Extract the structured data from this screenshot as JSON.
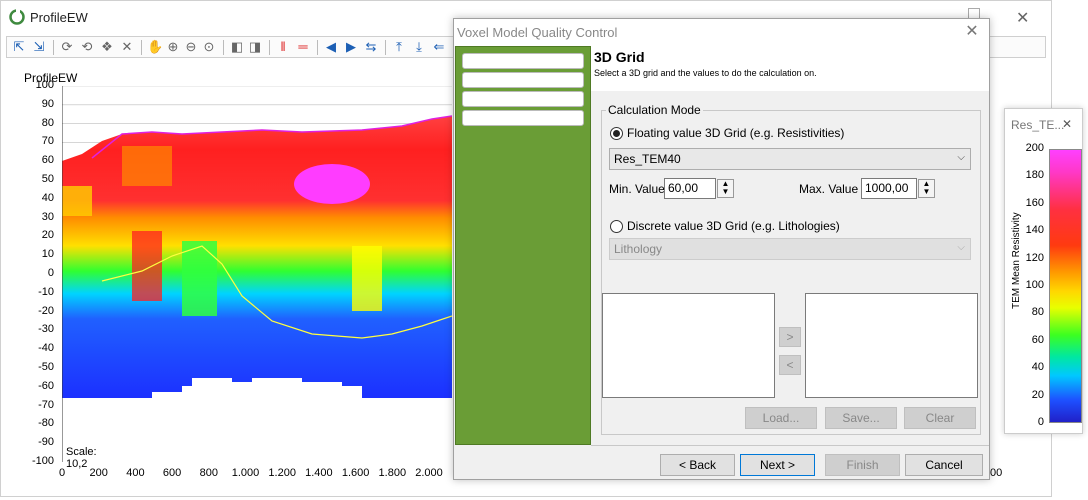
{
  "main": {
    "title": "ProfileEW",
    "plot_label": "ProfileEW",
    "scale_text": "Scale: 10,2",
    "partial_tick": "00"
  },
  "dialog": {
    "title": "Voxel Model Quality Control",
    "header_title": "3D Grid",
    "header_subtitle": "Select a 3D grid and the values to do the calculation on.",
    "group_title": "Calculation Mode",
    "floating_label": "Floating value 3D Grid (e.g. Resistivities)",
    "floating_selected": true,
    "floating_grid_value": "Res_TEM40",
    "min_label": "Min. Value",
    "min_value": "60,00",
    "max_label": "Max. Value",
    "max_value": "1000,00",
    "discrete_label": "Discrete value 3D Grid (e.g. Lithologies)",
    "discrete_selected": false,
    "discrete_grid_value": "Lithology",
    "move_right": ">",
    "move_left": "<",
    "load": "Load...",
    "save": "Save...",
    "clear": "Clear",
    "back": "< Back",
    "next": "Next >",
    "finish": "Finish",
    "cancel": "Cancel"
  },
  "colorbar": {
    "title": "Res_TE...",
    "axis_label": "TEM Mean Resistivity",
    "ticks": [
      "200",
      "180",
      "160",
      "140",
      "120",
      "100",
      "80",
      "60",
      "40",
      "20",
      "0"
    ],
    "colors": {
      "top": "#ff3fff",
      "bottom": "#2020c8"
    }
  },
  "chart_data": {
    "type": "heatmap",
    "title": "ProfileEW",
    "y_ticks": [
      "100",
      "90",
      "80",
      "70",
      "60",
      "50",
      "40",
      "30",
      "20",
      "10",
      "0",
      "-10",
      "-20",
      "-30",
      "-40",
      "-50",
      "-60",
      "-70",
      "-80",
      "-90",
      "-100"
    ],
    "x_ticks": [
      "0",
      "200",
      "400",
      "600",
      "800",
      "1.000",
      "1.200",
      "1.400",
      "1.600",
      "1.800",
      "2.000"
    ],
    "ylim": [
      -100,
      100
    ],
    "xlim": [
      0,
      2100
    ],
    "grid": true
  }
}
